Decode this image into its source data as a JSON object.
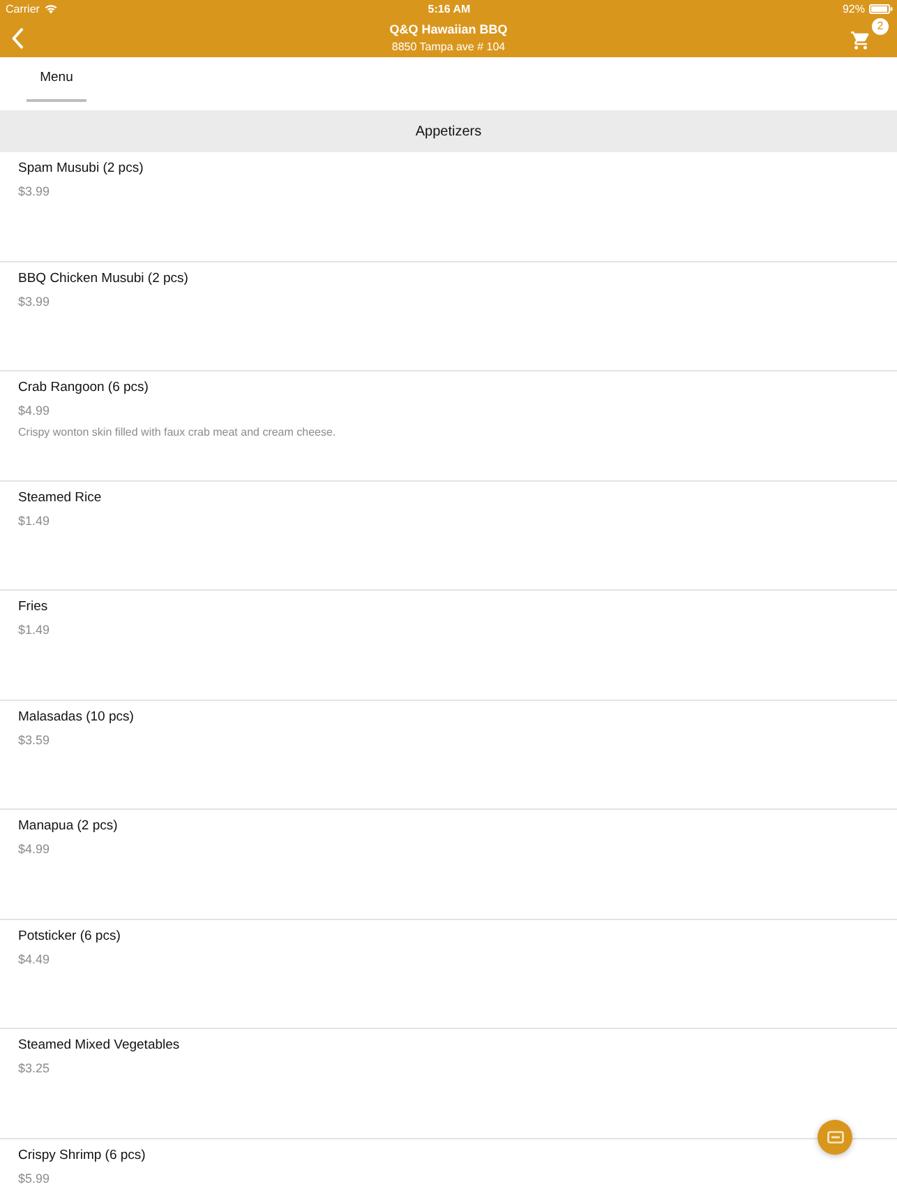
{
  "status_bar": {
    "carrier": "Carrier",
    "time": "5:16 AM",
    "battery": "92%"
  },
  "header": {
    "title": "Q&Q Hawaiian BBQ",
    "subtitle": "8850 Tampa ave # 104",
    "cart_count": "2"
  },
  "tabs": [
    {
      "label": "Menu",
      "selected": true
    }
  ],
  "section": {
    "title": "Appetizers"
  },
  "items": [
    {
      "name": "Spam Musubi (2 pcs)",
      "price": "$3.99"
    },
    {
      "name": "BBQ Chicken Musubi (2 pcs)",
      "price": "$3.99"
    },
    {
      "name": "Crab Rangoon (6 pcs)",
      "price": "$4.99",
      "description": "Crispy wonton skin filled with faux crab meat and cream cheese."
    },
    {
      "name": "Steamed Rice",
      "price": "$1.49"
    },
    {
      "name": "Fries",
      "price": "$1.49"
    },
    {
      "name": "Malasadas (10 pcs)",
      "price": "$3.59"
    },
    {
      "name": "Manapua (2 pcs)",
      "price": "$4.99"
    },
    {
      "name": "Potsticker (6 pcs)",
      "price": "$4.49"
    },
    {
      "name": "Steamed Mixed Vegetables",
      "price": "$3.25"
    },
    {
      "name": "Crispy Shrimp (6 pcs)",
      "price": "$5.99"
    }
  ]
}
